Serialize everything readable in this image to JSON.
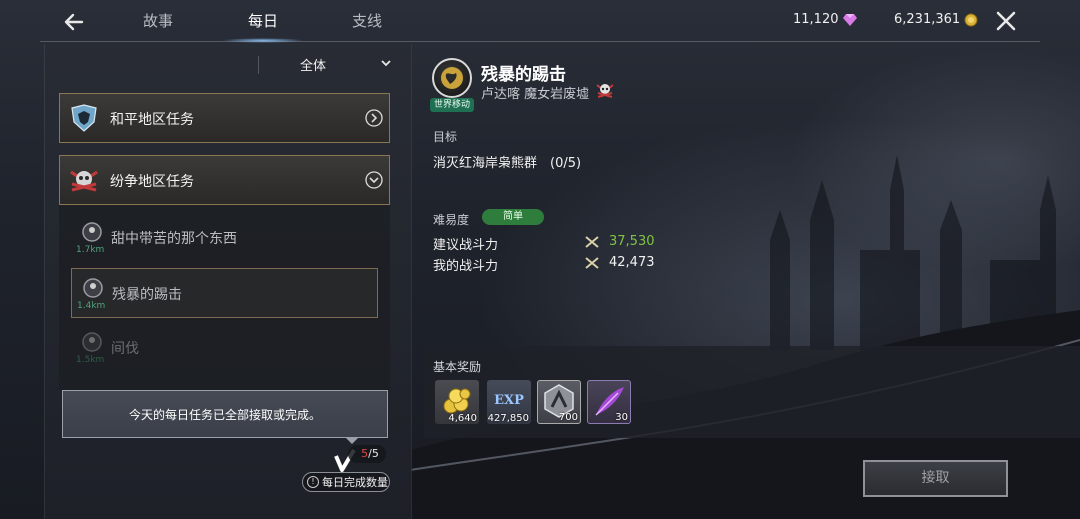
{
  "header": {
    "tabs": [
      {
        "label": "故事"
      },
      {
        "label": "每日"
      },
      {
        "label": "支线"
      }
    ],
    "active_tab": 1,
    "diamonds": "11,120",
    "gold": "6,231,361"
  },
  "left": {
    "filter_label": "全体",
    "regions": [
      {
        "label": "和平地区任务"
      },
      {
        "label": "纷争地区任务"
      }
    ],
    "quests": [
      {
        "name": "甜中带苦的那个东西",
        "distance": "1.7km"
      },
      {
        "name": "残暴的踢击",
        "distance": "1.4km"
      },
      {
        "name": "间伐",
        "distance": "1.5km"
      }
    ],
    "notice": "今天的每日任务已全部接取或完成。",
    "daily_done": "5",
    "daily_total": "/5",
    "daily_count_label": "每日完成数量"
  },
  "detail": {
    "world_move_label": "世界移动",
    "title": "残暴的踢击",
    "location": "卢达喀 魔女岩废墟",
    "objective_label": "目标",
    "objective": "消灭红海岸枭熊群　(0/5)",
    "difficulty_label": "难易度",
    "difficulty": "简单",
    "recommended_power_label": "建议战斗力",
    "recommended_power": "37,530",
    "my_power_label": "我的战斗力",
    "my_power": "42,473",
    "rewards_label": "基本奖励",
    "rewards": [
      {
        "icon": "gold-coins-icon",
        "amount": "4,640"
      },
      {
        "icon": "exp-icon",
        "amount": "427,850"
      },
      {
        "icon": "silver-emblem-icon",
        "amount": "700"
      },
      {
        "icon": "purple-feather-icon",
        "amount": "30"
      }
    ],
    "accept_label": "接取"
  },
  "colors": {
    "accent_green": "#7fc342",
    "difficulty_badge": "#2f7d3c",
    "region_border": "#8a7650",
    "daily_done": "#e04848"
  }
}
